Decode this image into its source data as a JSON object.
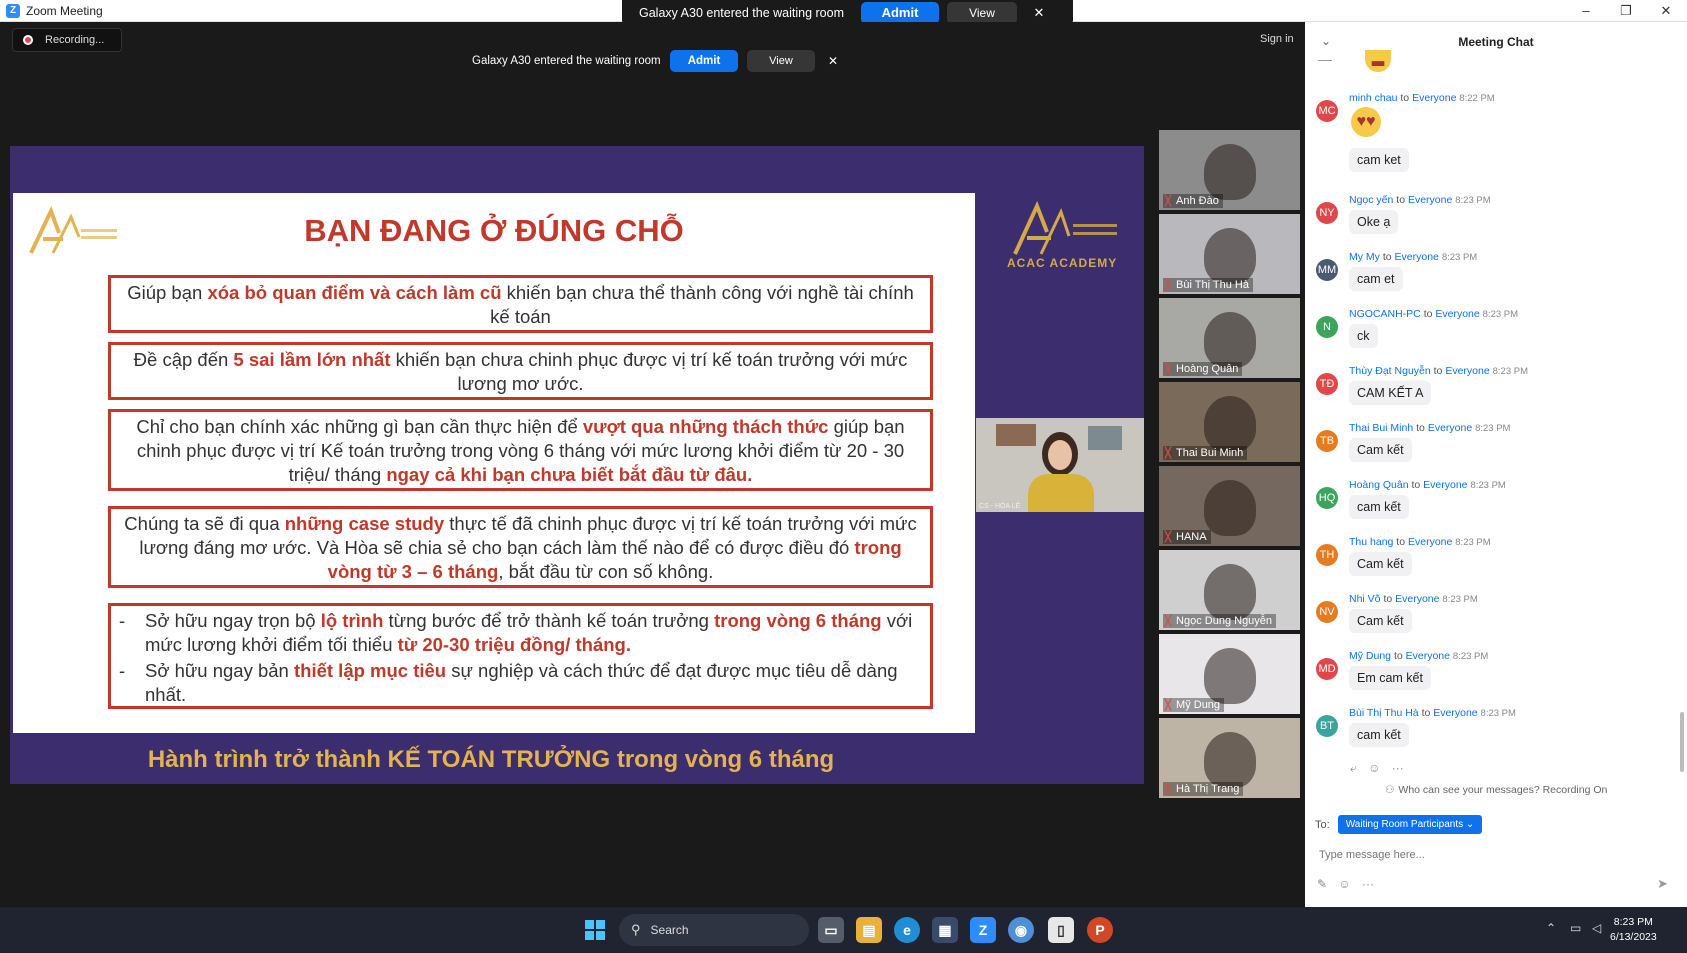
{
  "window": {
    "title": "Zoom Meeting",
    "minimize": "–",
    "restore": "❐",
    "close": "✕"
  },
  "top_notification": {
    "message": "Galaxy A30 entered the waiting room",
    "admit": "Admit",
    "view": "View",
    "close": "✕"
  },
  "inline_notification": {
    "message": "Galaxy A30 entered the waiting room",
    "admit": "Admit",
    "view": "View",
    "close": "✕"
  },
  "recording": {
    "label": "Recording..."
  },
  "signin": "Sign in",
  "slide": {
    "title": "BẠN ĐANG Ở ĐÚNG CHỖ",
    "academy": "ACAC ACADEMY",
    "box1": [
      "Giúp bạn ",
      "xóa bỏ quan điểm và cách làm cũ",
      " khiến bạn chưa thể thành công với nghề tài chính kế toán"
    ],
    "box2": [
      "Đề cập đến ",
      "5 sai lầm lớn nhất",
      " khiến bạn chưa chinh phục được vị trí kế toán trưởng với mức lương mơ ước."
    ],
    "box3": [
      "Chỉ cho bạn chính xác những gì bạn cần thực hiện để ",
      "vượt qua những thách thức",
      " giúp bạn chinh phục được vị trí Kế toán trưởng trong vòng 6 tháng với mức lương khởi điểm từ 20 - 30 triệu/ tháng ",
      "ngay cả khi bạn chưa biết bắt đầu từ đâu."
    ],
    "box4": [
      "Chúng ta sẽ đi qua ",
      "những case study",
      " thực tế đã chinh phục được vị trí kế toán trưởng với mức lương đáng mơ ước. Và Hòa sẽ chia sẻ cho bạn cách làm thế nào để có được điều đó ",
      "trong vòng từ 3 – 6 tháng",
      ", bắt đầu từ con số không."
    ],
    "box5a": [
      "Sở hữu ngay trọn bộ ",
      "lộ trình",
      " từng bước để trở thành kế toán trưởng ",
      "trong vòng 6 tháng",
      " với mức lương khởi điểm tối thiểu ",
      "từ 20-30 triệu đồng/ tháng."
    ],
    "box5b": [
      "Sở hữu ngay bản ",
      "thiết lập mục tiêu",
      " sự nghiệp và cách thức để đạt được mục tiêu dễ dàng nhất."
    ],
    "footer": "Hành trình trở thành KẾ TOÁN TRƯỞNG trong vòng 6 tháng"
  },
  "presenter": {
    "label": "CS - HÒA LÊ"
  },
  "participants": [
    {
      "name": "Anh Đào",
      "bg": "#8c8c8c"
    },
    {
      "name": "Bùi Thị Thu Hà",
      "bg": "#b9b9bd"
    },
    {
      "name": "Hoàng Quân",
      "bg": "#a8a9a4"
    },
    {
      "name": "Thai Bui Minh",
      "bg": "#7a6a5a"
    },
    {
      "name": "HANA",
      "bg": "#75685e"
    },
    {
      "name": "Ngọc Dung Nguyễn",
      "bg": "#cfcfd0"
    },
    {
      "name": "Mỹ Dung",
      "bg": "#e9e6ea"
    },
    {
      "name": "Hà Thị Trang",
      "bg": "#bdb4a6"
    }
  ],
  "chat": {
    "title": "Meeting Chat",
    "messages": [
      {
        "initials": "MC",
        "color": "#e0464a",
        "sender": "minh chau",
        "to": "to",
        "recipient": "Everyone",
        "time": "8:22 PM",
        "text": "cam ket"
      },
      {
        "initials": "NY",
        "color": "#e0464a",
        "sender": "Ngọc yến",
        "to": "to",
        "recipient": "Everyone",
        "time": "8:23 PM",
        "text": "Oke ạ"
      },
      {
        "initials": "MM",
        "color": "#4a5a73",
        "sender": "My My",
        "to": "to",
        "recipient": "Everyone",
        "time": "8:23 PM",
        "text": "cam et"
      },
      {
        "initials": "N",
        "color": "#3aa55b",
        "sender": "NGOCANH-PC",
        "to": "to",
        "recipient": "Everyone",
        "time": "8:23 PM",
        "text": "ck"
      },
      {
        "initials": "TĐ",
        "color": "#e0464a",
        "sender": "Thùy Đạt Nguyễn",
        "to": "to",
        "recipient": "Everyone",
        "time": "8:23 PM",
        "text": "CAM KẾT A"
      },
      {
        "initials": "TB",
        "color": "#e57c1f",
        "sender": "Thai Bui Minh",
        "to": "to",
        "recipient": "Everyone",
        "time": "8:23 PM",
        "text": "Cam kết"
      },
      {
        "initials": "HQ",
        "color": "#3aa55b",
        "sender": "Hoàng Quân",
        "to": "to",
        "recipient": "Everyone",
        "time": "8:23 PM",
        "text": "cam kết"
      },
      {
        "initials": "TH",
        "color": "#e57c1f",
        "sender": "Thu hang",
        "to": "to",
        "recipient": "Everyone",
        "time": "8:23 PM",
        "text": "Cam kết"
      },
      {
        "initials": "NV",
        "color": "#e57c1f",
        "sender": "Nhi Võ",
        "to": "to",
        "recipient": "Everyone",
        "time": "8:23 PM",
        "text": "Cam kết"
      },
      {
        "initials": "MD",
        "color": "#e0464a",
        "sender": "Mỹ Dung",
        "to": "to",
        "recipient": "Everyone",
        "time": "8:23 PM",
        "text": "Em cam kết"
      },
      {
        "initials": "BT",
        "color": "#3aa5a0",
        "sender": "Bùi Thị Thu Hà",
        "to": "to",
        "recipient": "Everyone",
        "time": "8:23 PM",
        "text": "cam kết"
      }
    ],
    "notice": "Who can see your messages? Recording On",
    "to_label": "To:",
    "to_value": "Waiting Room Participants ⌄",
    "input_placeholder": "Type message here..."
  },
  "taskbar": {
    "search": "Search",
    "time": "8:23 PM",
    "date": "6/13/2023"
  }
}
